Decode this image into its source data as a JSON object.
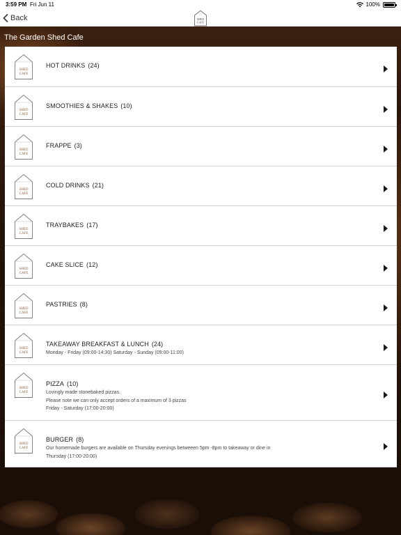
{
  "status_bar": {
    "time": "3:59 PM",
    "date": "Fri Jun 11",
    "battery": "100%"
  },
  "nav": {
    "back_label": "Back",
    "logo_text_line1": "SHED",
    "logo_text_line2": "CAFE"
  },
  "page": {
    "title": "The Garden Shed Cafe"
  },
  "categories": [
    {
      "name": "HOT DRINKS",
      "count": "(24)",
      "desc": []
    },
    {
      "name": "SMOOTHIES & SHAKES",
      "count": "(10)",
      "desc": []
    },
    {
      "name": "FRAPPE",
      "count": "(3)",
      "desc": []
    },
    {
      "name": "COLD DRINKS",
      "count": "(21)",
      "desc": []
    },
    {
      "name": "TRAYBAKES",
      "count": "(17)",
      "desc": []
    },
    {
      "name": "CAKE SLICE",
      "count": "(12)",
      "desc": []
    },
    {
      "name": "PASTRIES",
      "count": "(8)",
      "desc": []
    },
    {
      "name": "TAKEAWAY BREAKFAST & LUNCH",
      "count": "(24)",
      "desc": [
        "Monday - Friday (09:00-14:30) Saturday - Sunday (09:00-11:00)"
      ]
    },
    {
      "name": "PIZZA",
      "count": "(10)",
      "desc": [
        "Lovingly made stonebaked pizzas.",
        "Please note we can only accept orders of a maximum of 3 pizzas",
        "Friday - Saturday (17:00-20:00)"
      ]
    },
    {
      "name": "BURGER",
      "count": "(8)",
      "desc": [
        "Our homemade burgers are available on Thursday evenings betweeen 5pm -8pm to takeaway or dine in",
        "Thursday (17:00-20:00)"
      ]
    }
  ]
}
